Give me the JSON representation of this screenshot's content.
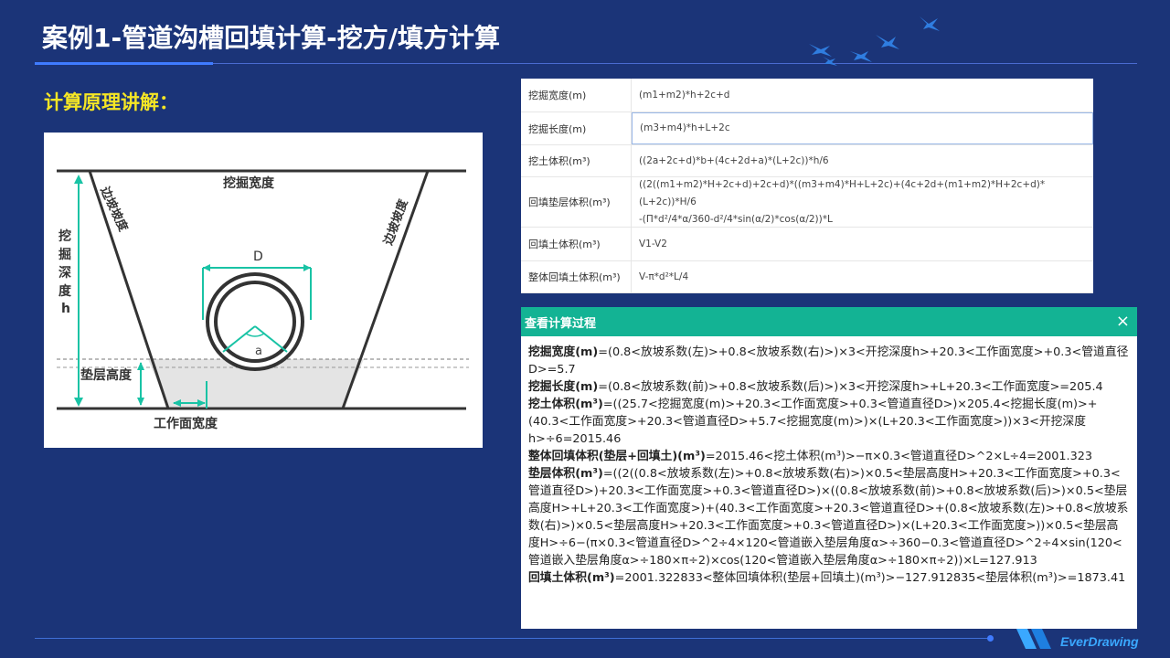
{
  "slide": {
    "title": "案例1-管道沟槽回填计算-挖方/填方计算",
    "subtitle": "计算原理讲解：",
    "logo_text": "EverDrawing"
  },
  "diagram": {
    "labels": {
      "top": "挖掘宽度",
      "slope_left": "边坡坡度",
      "slope_right": "边坡坡度",
      "depth": [
        "挖",
        "掘",
        "深",
        "度",
        "h"
      ],
      "pipe_d": "D",
      "angle": "a",
      "bedding": "垫层高度",
      "work_width": "工作面宽度"
    }
  },
  "formula_table": {
    "rows": [
      {
        "label": "挖掘宽度(m)",
        "value": [
          "(m1+m2)*h+2c+d"
        ]
      },
      {
        "label": "挖掘长度(m)",
        "value": [
          "(m3+m4)*h+L+2c"
        ]
      },
      {
        "label": "挖土体积(m³)",
        "value": [
          "((2a+2c+d)*b+(4c+2d+a)*(L+2c))*h/6"
        ]
      },
      {
        "label": "回填垫层体积(m³)",
        "value": [
          "((2((m1+m2)*H+2c+d)+2c+d)*((m3+m4)*H+L+2c)+(4c+2d+(m1+m2)*H+2c+d)*(L+2c))*H/6",
          "-(Π*d²/4*α/360-d²/4*sin(α/2)*cos(α/2))*L"
        ]
      },
      {
        "label": "回填土体积(m³)",
        "value": [
          "V1-V2"
        ]
      },
      {
        "label": "整体回填土体积(m³)",
        "value": [
          "V-π*d²*L/4"
        ]
      }
    ]
  },
  "dialog": {
    "title": "查看计算过程",
    "close_label": "×",
    "entries": [
      {
        "name": "挖掘宽度(m)",
        "expr": "=(0.8<放坡系数(左)>+0.8<放坡系数(右)>)×3<开挖深度h>+20.3<工作面宽度>+0.3<管道直径D>=5.7"
      },
      {
        "name": "挖掘长度(m)",
        "expr": "=(0.8<放坡系数(前)>+0.8<放坡系数(后)>)×3<开挖深度h>+L+20.3<工作面宽度>=205.4"
      },
      {
        "name": "挖土体积(m³)",
        "expr": "=((25.7<挖掘宽度(m)>+20.3<工作面宽度>+0.3<管道直径D>)×205.4<挖掘长度(m)>+(40.3<工作面宽度>+20.3<管道直径D>+5.7<挖掘宽度(m)>)×(L+20.3<工作面宽度>))×3<开挖深度h>÷6=2015.46"
      },
      {
        "name": "整体回填体积(垫层+回填土)(m³)",
        "expr": "=2015.46<挖土体积(m³)>−π×0.3<管道直径D>^2×L÷4=2001.323"
      },
      {
        "name": "垫层体积(m³)",
        "expr": "=((2((0.8<放坡系数(左)>+0.8<放坡系数(右)>)×0.5<垫层高度H>+20.3<工作面宽度>+0.3<管道直径D>)+20.3<工作面宽度>+0.3<管道直径D>)×((0.8<放坡系数(前)>+0.8<放坡系数(后)>)×0.5<垫层高度H>+L+20.3<工作面宽度>)+(40.3<工作面宽度>+20.3<管道直径D>+(0.8<放坡系数(左)>+0.8<放坡系数(右)>)×0.5<垫层高度H>+20.3<工作面宽度>+0.3<管道直径D>)×(L+20.3<工作面宽度>))×0.5<垫层高度H>÷6−(π×0.3<管道直径D>^2÷4×120<管道嵌入垫层角度α>÷360−0.3<管道直径D>^2÷4×sin(120<管道嵌入垫层角度α>÷180×π÷2)×cos(120<管道嵌入垫层角度α>÷180×π÷2))×L=127.913"
      },
      {
        "name": "回填土体积(m³)",
        "expr": "=2001.322833<整体回填体积(垫层+回填土)(m³)>−127.912835<垫层体积(m³)>=1873.41"
      }
    ]
  }
}
